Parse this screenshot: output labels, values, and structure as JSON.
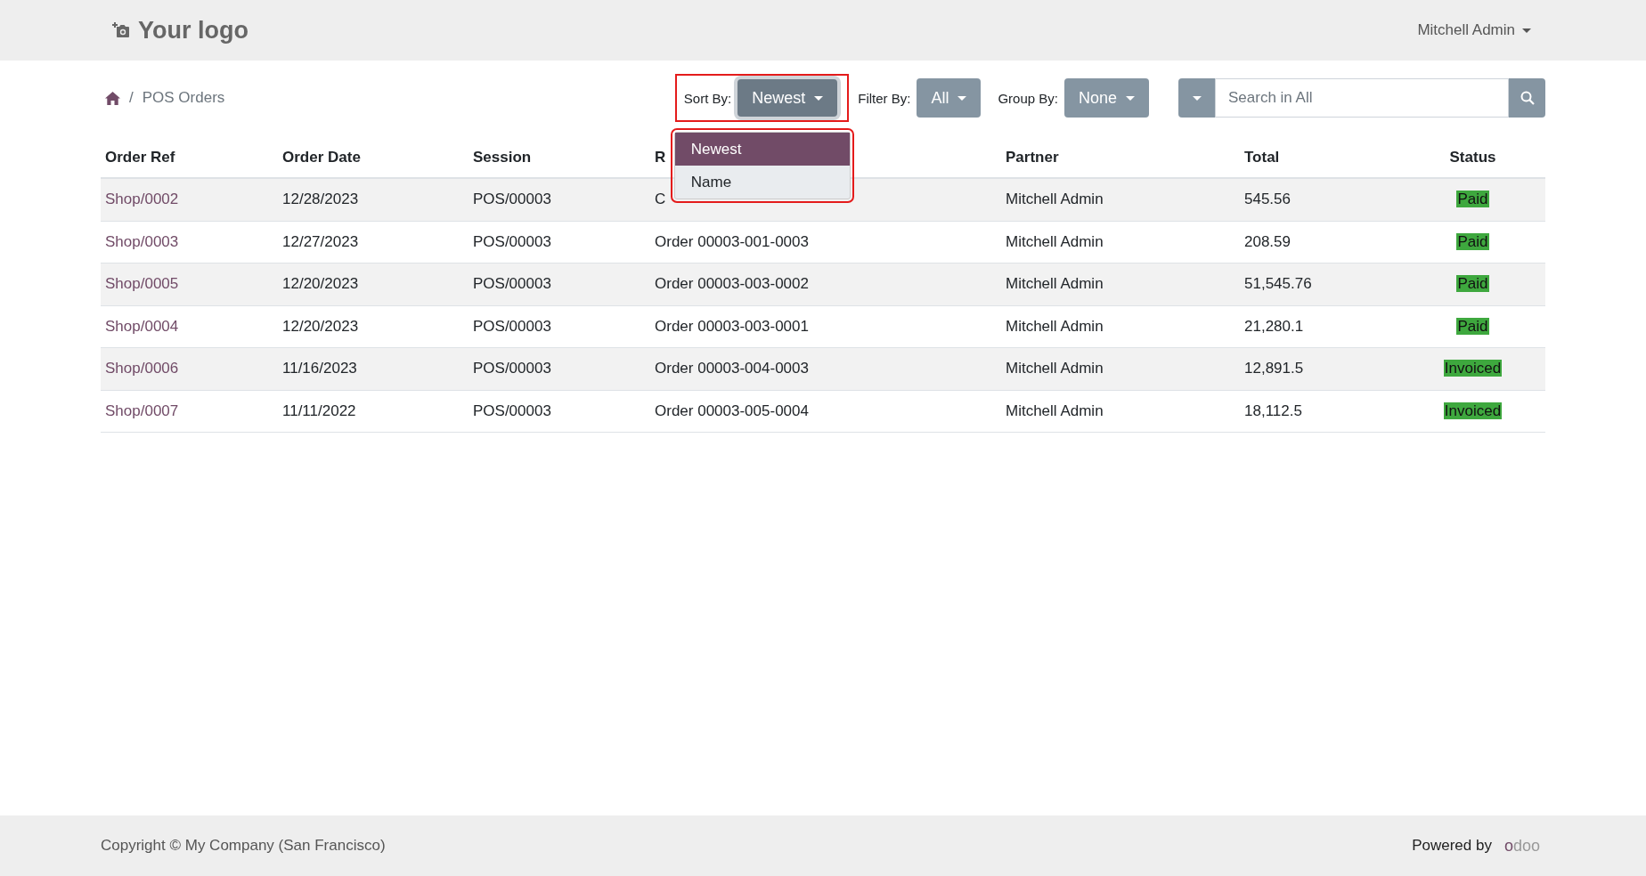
{
  "header": {
    "logo": "Your logo",
    "user": "Mitchell Admin"
  },
  "breadcrumb": {
    "separator": "/",
    "page": "POS Orders"
  },
  "sort": {
    "label": "Sort By:",
    "value": "Newest",
    "highlighted": true,
    "expanded": true,
    "menu": {
      "highlighted": true,
      "items": [
        {
          "label": "Newest",
          "selected": true
        },
        {
          "label": "Name",
          "selected": false
        }
      ]
    }
  },
  "filter": {
    "label": "Filter By:",
    "value": "All"
  },
  "group": {
    "label": "Group By:",
    "value": "None"
  },
  "search": {
    "placeholder": "Search in All"
  },
  "table": {
    "columns": [
      "Order Ref",
      "Order Date",
      "Session",
      "R",
      "Partner",
      "Total",
      "Status"
    ],
    "rows": [
      {
        "ref": "Shop/0002",
        "date": "12/28/2023",
        "session": "POS/00003",
        "reference": "C",
        "partner": "Mitchell Admin",
        "total": "545.56",
        "status": "Paid"
      },
      {
        "ref": "Shop/0003",
        "date": "12/27/2023",
        "session": "POS/00003",
        "reference": "Order 00003-001-0003",
        "partner": "Mitchell Admin",
        "total": "208.59",
        "status": "Paid"
      },
      {
        "ref": "Shop/0005",
        "date": "12/20/2023",
        "session": "POS/00003",
        "reference": "Order 00003-003-0002",
        "partner": "Mitchell Admin",
        "total": "51,545.76",
        "status": "Paid"
      },
      {
        "ref": "Shop/0004",
        "date": "12/20/2023",
        "session": "POS/00003",
        "reference": "Order 00003-003-0001",
        "partner": "Mitchell Admin",
        "total": "21,280.1",
        "status": "Paid"
      },
      {
        "ref": "Shop/0006",
        "date": "11/16/2023",
        "session": "POS/00003",
        "reference": "Order 00003-004-0003",
        "partner": "Mitchell Admin",
        "total": "12,891.5",
        "status": "Invoiced"
      },
      {
        "ref": "Shop/0007",
        "date": "11/11/2022",
        "session": "POS/00003",
        "reference": "Order 00003-005-0004",
        "partner": "Mitchell Admin",
        "total": "18,112.5",
        "status": "Invoiced"
      }
    ]
  },
  "footer": {
    "copyright": "Copyright © My Company (San Francisco)",
    "powered": "Powered by",
    "brand": "odoo"
  }
}
